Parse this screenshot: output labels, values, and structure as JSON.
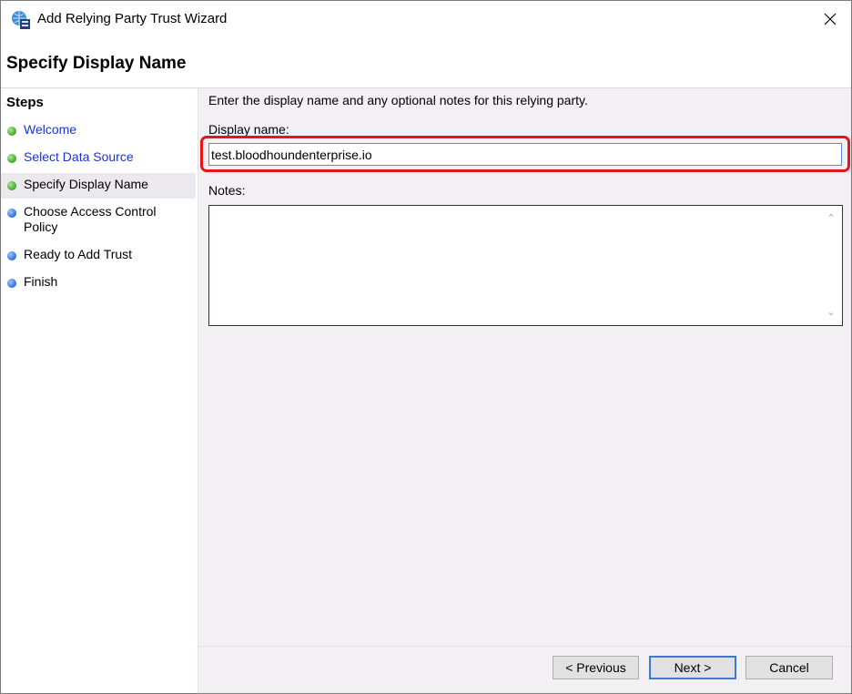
{
  "window": {
    "title": "Add Relying Party Trust Wizard"
  },
  "header": {
    "title": "Specify Display Name"
  },
  "steps": {
    "heading": "Steps",
    "items": [
      {
        "label": "Welcome",
        "state": "completed",
        "bullet_color": "#3fa52a"
      },
      {
        "label": "Select Data Source",
        "state": "completed",
        "bullet_color": "#3fa52a"
      },
      {
        "label": "Specify Display Name",
        "state": "current",
        "bullet_color": "#3fa52a"
      },
      {
        "label": "Choose Access Control Policy",
        "state": "pending",
        "bullet_color": "#2a6fd8"
      },
      {
        "label": "Ready to Add Trust",
        "state": "pending",
        "bullet_color": "#2a6fd8"
      },
      {
        "label": "Finish",
        "state": "pending",
        "bullet_color": "#2a6fd8"
      }
    ]
  },
  "main": {
    "description": "Enter the display name and any optional notes for this relying party.",
    "display_name_label": "Display name:",
    "display_name_value": "test.bloodhoundenterprise.io",
    "notes_label": "Notes:",
    "notes_value": ""
  },
  "buttons": {
    "previous": "< Previous",
    "next": "Next >",
    "cancel": "Cancel"
  },
  "colors": {
    "highlight": "#e8141b",
    "link": "#1b34d1",
    "content_background": "#f2f0f3"
  }
}
